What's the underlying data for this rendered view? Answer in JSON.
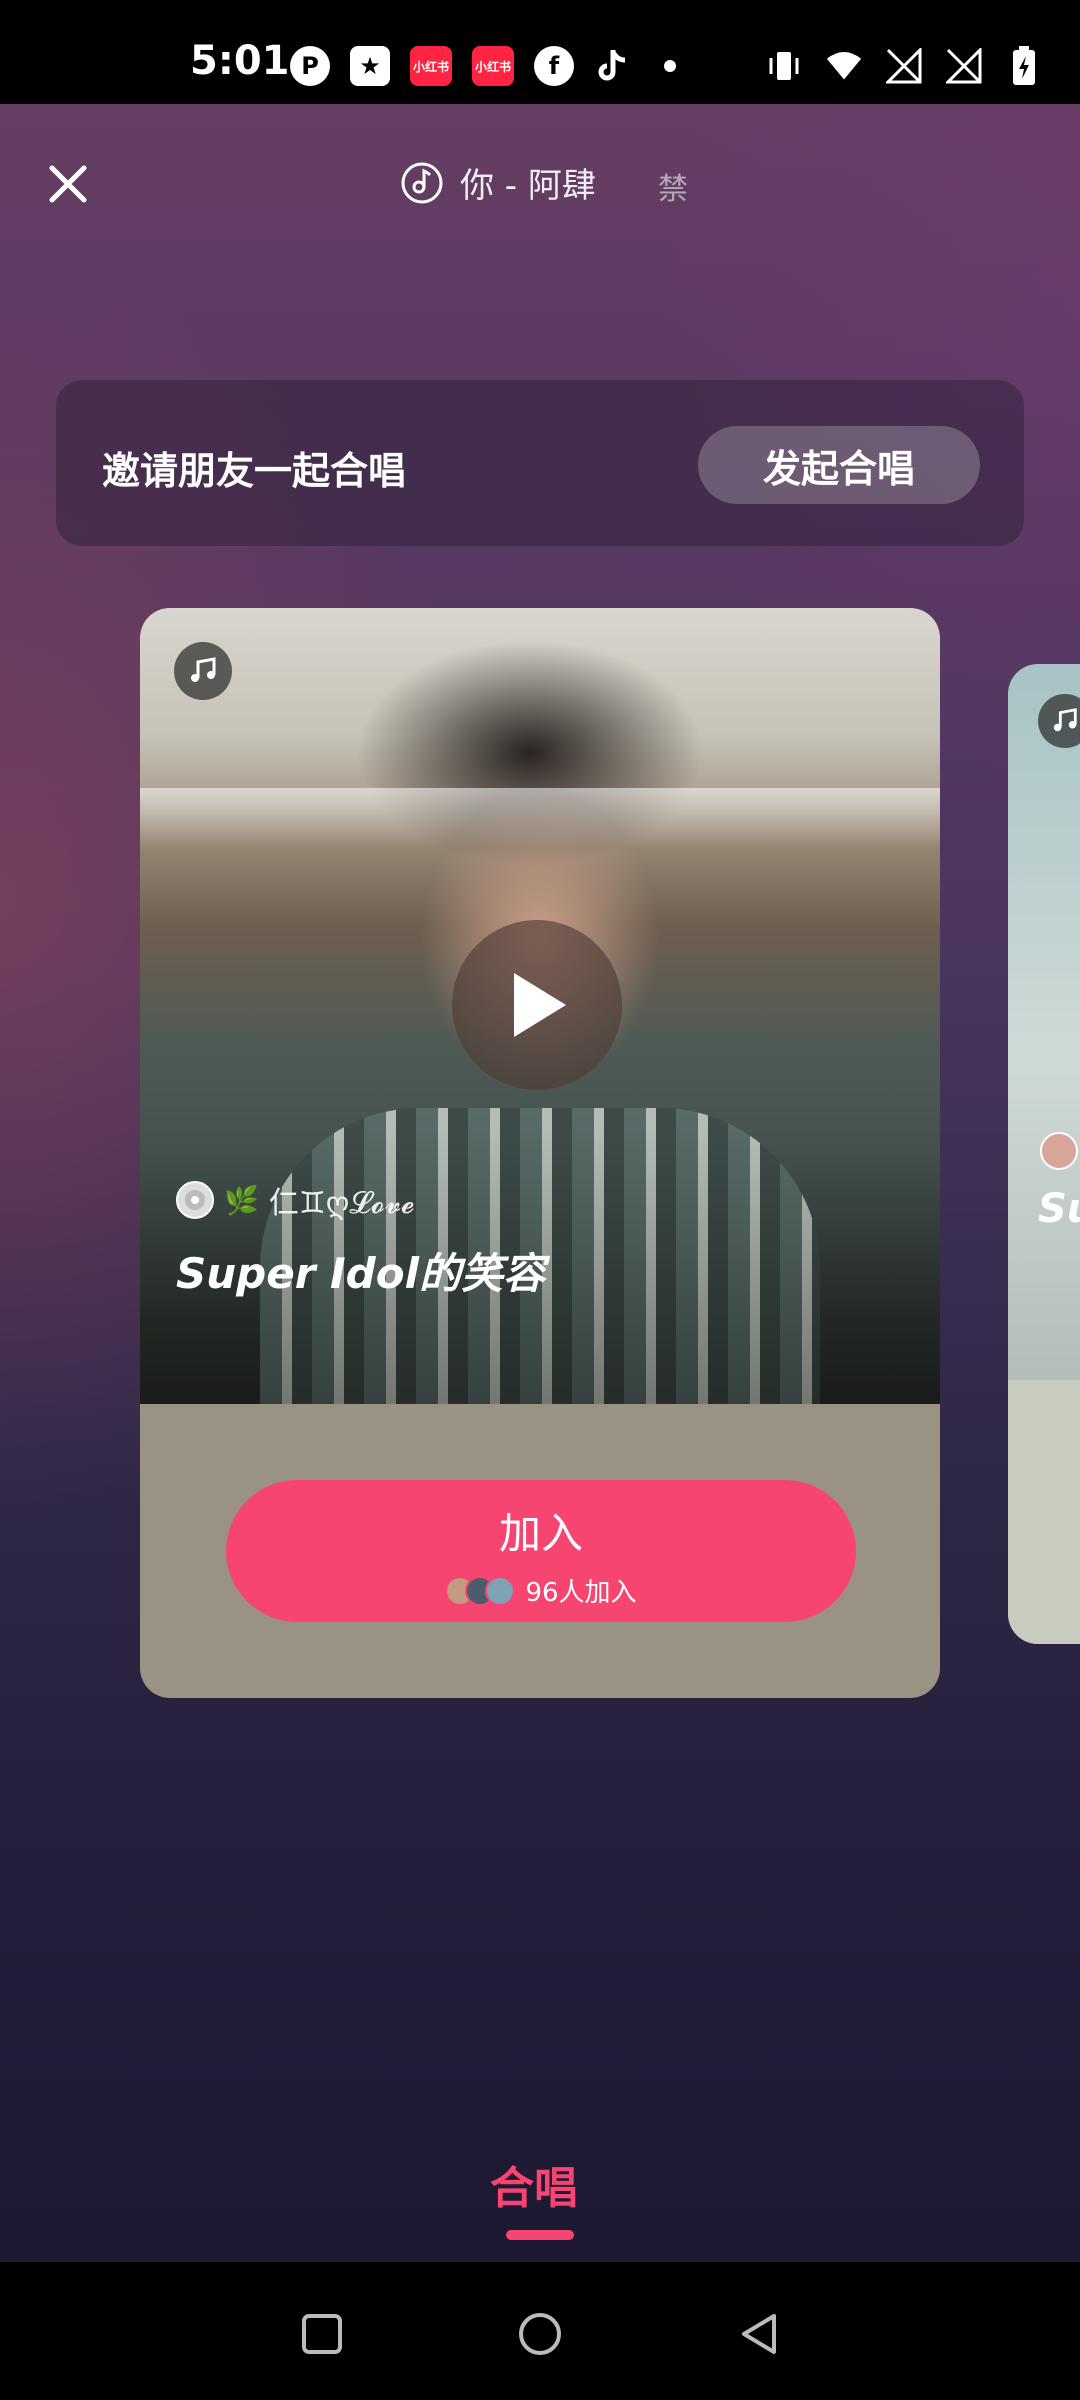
{
  "status_bar": {
    "time": "5:01",
    "app_icons": [
      "p-icon",
      "star-icon",
      "xiaohongshu-icon",
      "xiaohongshu-icon",
      "facebook-icon",
      "tiktok-icon",
      "dot-icon"
    ],
    "xhs_label": "小红书",
    "right_icons": [
      "vibrate-icon",
      "wifi-icon",
      "no-signal-icon",
      "no-signal-icon",
      "battery-charging-icon"
    ]
  },
  "header": {
    "now_playing": "你 - 阿肆",
    "next_song_hint": "禁"
  },
  "invite": {
    "text": "邀请朋友一起合唱",
    "button_label": "发起合唱"
  },
  "card": {
    "owner_name": "仁♊ღ𝓛𝓸𝓿𝓮",
    "song_title": "Super Idol的笑容",
    "join_label": "加入",
    "join_count": "96人加入"
  },
  "next_card": {
    "title_fragment": "Su"
  },
  "bottom_tab": {
    "label": "合唱"
  },
  "colors": {
    "accent": "#f64570",
    "background_top": "#6a3f63",
    "background_bottom": "#1b1730"
  }
}
